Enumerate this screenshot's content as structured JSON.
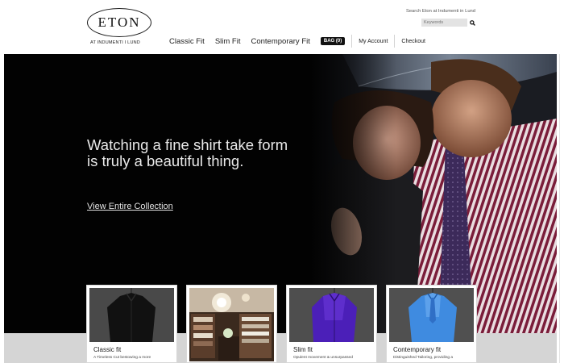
{
  "brand": {
    "logo_text": "ETON",
    "logo_sub": "AT INDUMENTI I LUND"
  },
  "search": {
    "caption": "Search Eton at Indumenti in Lund",
    "placeholder": "Keywords",
    "icon": "search-icon"
  },
  "nav": {
    "items": [
      {
        "label": "Classic Fit"
      },
      {
        "label": "Slim Fit"
      },
      {
        "label": "Contemporary Fit"
      }
    ],
    "bag_label": "BAG (0)",
    "my_account": "My Account",
    "checkout": "Checkout"
  },
  "hero": {
    "headline": "Watching a fine shirt take form is truly a beautiful thing.",
    "link": "View Entire Collection"
  },
  "cards": [
    {
      "title": "Classic fit",
      "desc": "A Timeless Cut bestowing a more",
      "image": "black-shirt"
    },
    {
      "title": "",
      "desc": "",
      "image": "store-interior"
    },
    {
      "title": "Slim fit",
      "desc": "Opulent movement & unsurpassed",
      "image": "purple-shirt"
    },
    {
      "title": "Contemporary fit",
      "desc": "Distinguished Tailoring, providing a",
      "image": "blue-shirt"
    }
  ],
  "colors": {
    "hero_bg": "#020202",
    "headline": "#e9e9e9",
    "band": "#d5d5d5"
  }
}
